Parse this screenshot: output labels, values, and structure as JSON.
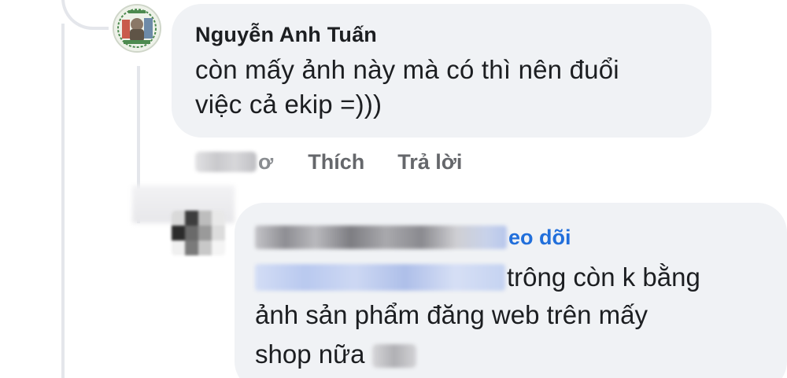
{
  "comment": {
    "author": "Nguyễn Anh Tuấn",
    "text_line1": "còn mấy ảnh này mà có thì nên đuổi",
    "text_line2": "việc cả ekip =)))",
    "time_suffix": "ơ",
    "like_label": "Thích",
    "reply_label": "Trả lời"
  },
  "reply": {
    "follow_suffix": "eo dõi",
    "text_line1": "trông còn k bằng",
    "text_line2": "ảnh sản phẩm đăng web trên mấy",
    "text_line3": "shop nữa"
  },
  "colors": {
    "bubble": "#f0f2f5",
    "text": "#1c1e21",
    "secondary": "#65676b",
    "link": "#216fdb",
    "thread_line": "#e4e6eb"
  },
  "icons": {
    "avatar": "user-avatar-icon"
  }
}
